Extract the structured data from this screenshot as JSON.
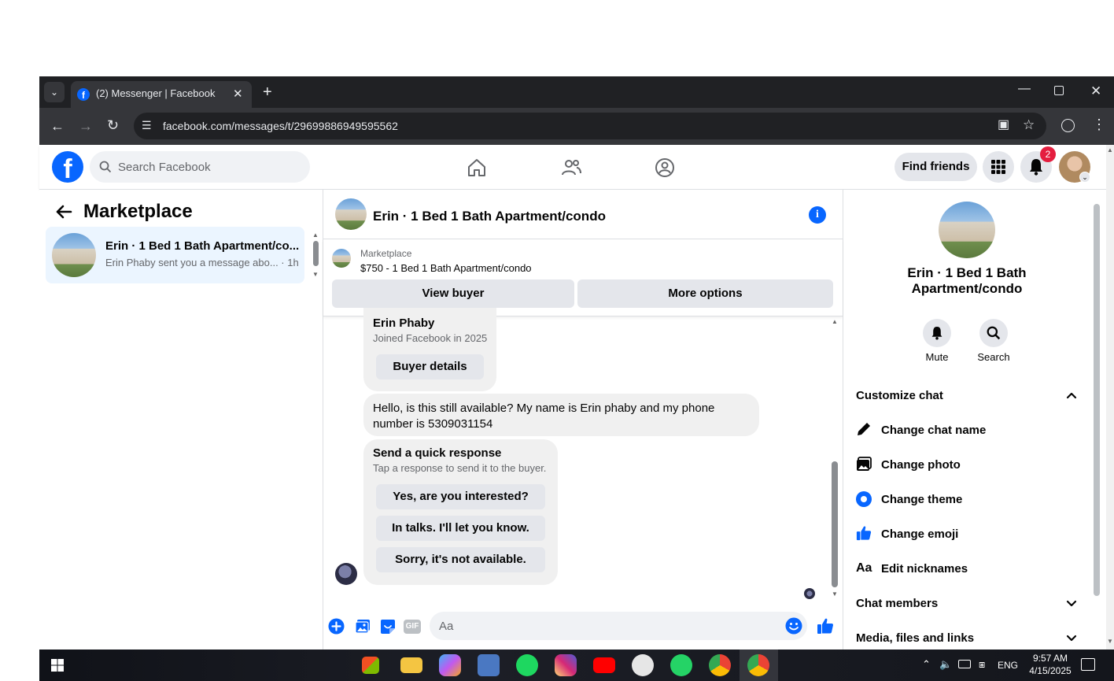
{
  "browser": {
    "tab_title": "(2) Messenger | Facebook",
    "url": "facebook.com/messages/t/29699886949595562"
  },
  "fb": {
    "search_placeholder": "Search Facebook",
    "find_friends": "Find friends",
    "notification_count": "2"
  },
  "left": {
    "title": "Marketplace",
    "conversations": [
      {
        "name": "Erin · 1 Bed 1 Bath Apartment/co...",
        "snippet": "Erin Phaby sent you a message abo... · 1h"
      }
    ]
  },
  "chat": {
    "title": "Erin · 1 Bed 1 Bath Apartment/condo",
    "marketplace_label": "Marketplace",
    "listing": "$750 - 1 Bed 1 Bath Apartment/condo",
    "view_buyer": "View buyer",
    "more_options": "More options",
    "buyer_card": {
      "name": "Erin Phaby",
      "joined": "Joined Facebook in 2025",
      "button": "Buyer details"
    },
    "message_line1": "Hello, is this still available? My name is Erin phaby and my phone",
    "message_line2": "number is 5309031154",
    "quick": {
      "title": "Send a quick response",
      "subtitle": "Tap a response to send it to the buyer.",
      "options": [
        "Yes, are you interested?",
        "In talks. I'll let you know.",
        "Sorry, it's not available."
      ]
    },
    "composer_placeholder": "Aa",
    "gif_label": "GIF"
  },
  "details": {
    "title_line1": "Erin · 1 Bed 1 Bath",
    "title_line2": "Apartment/condo",
    "mute": "Mute",
    "search": "Search",
    "customize": "Customize chat",
    "items": [
      "Change chat name",
      "Change photo",
      "Change theme",
      "Change emoji",
      "Edit nicknames"
    ],
    "edit_icon_text": "Aa",
    "chat_members": "Chat members",
    "media": "Media, files and links"
  },
  "taskbar": {
    "time": "9:57 AM",
    "date": "4/15/2025",
    "lang": "ENG"
  },
  "colors": {
    "accent": "#0866ff",
    "bubble": "#f0f0f0",
    "button": "#e4e6eb"
  }
}
